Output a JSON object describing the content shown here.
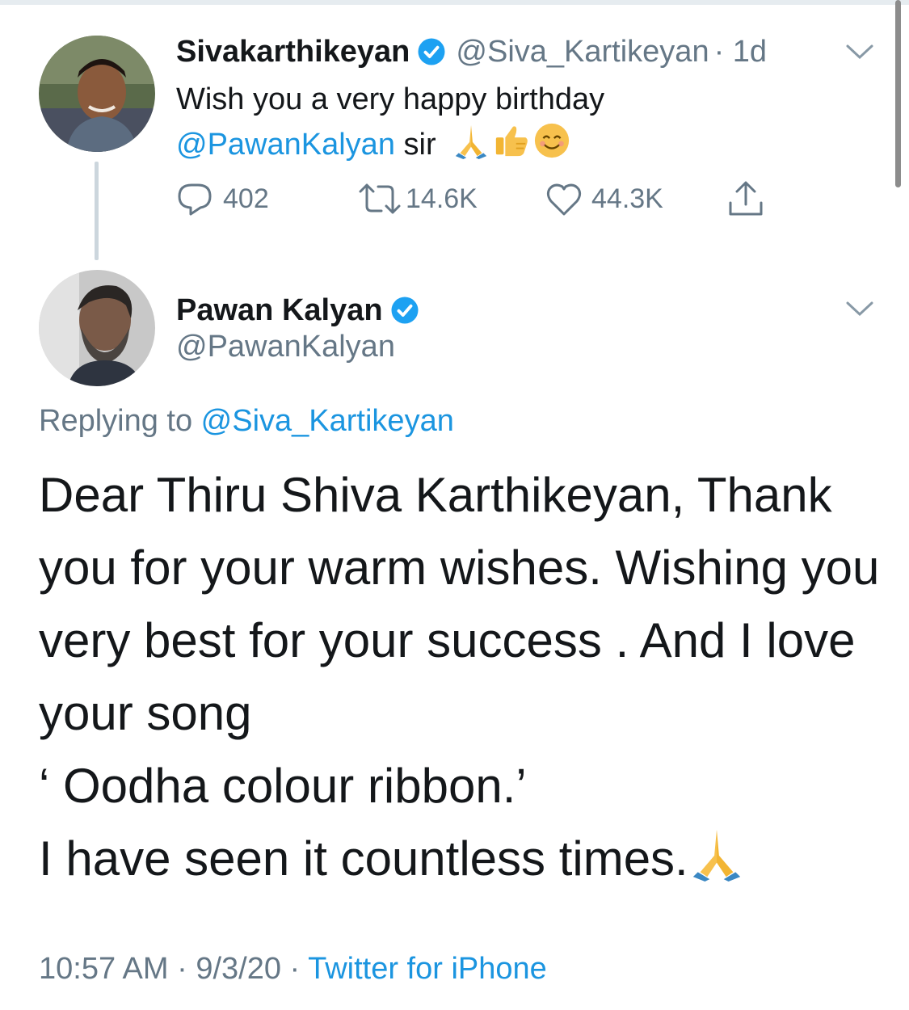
{
  "tweet1": {
    "name": "Sivakarthikeyan",
    "handle": "@Siva_Kartikeyan",
    "time": "· 1d",
    "text_line1": "Wish you a very happy birthday",
    "mention": "@PawanKalyan",
    "text_after_mention": " sir",
    "emojis": [
      "folded-hands-icon",
      "thumbs-up-icon",
      "smiling-face-icon"
    ],
    "replies": "402",
    "retweets": "14.6K",
    "likes": "44.3K"
  },
  "tweet2": {
    "name": "Pawan Kalyan",
    "handle": "@PawanKalyan",
    "replying_label": "Replying to ",
    "replying_handle": "@Siva_Kartikeyan",
    "lines": [
      "Dear Thiru Shiva Karthikeyan, Thank",
      "you for your warm wishes. Wishing you",
      "very best for your success . And I love",
      "your song",
      "‘ Oodha colour ribbon.’",
      "I have seen it countless times."
    ],
    "time": "10:57 AM",
    "date": "9/3/20",
    "source": "Twitter for iPhone",
    "separator": " · "
  },
  "colors": {
    "link": "#1b95e0",
    "secondary_text": "#657786",
    "primary_text": "#14171a",
    "verified": "#1da1f2"
  }
}
